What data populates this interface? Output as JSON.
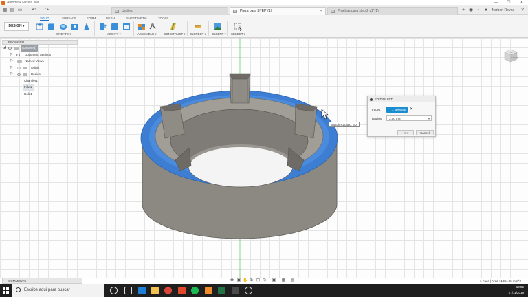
{
  "window": {
    "title": "Autodesk Fusion 360",
    "controls": [
      "—",
      "☐",
      "✕"
    ]
  },
  "tabs": [
    {
      "label": "Untitled",
      "active": false
    },
    {
      "label": "Pieza para STEP*(1)",
      "active": true
    },
    {
      "label": "Pruebas para step 2 v1*(1)",
      "active": false
    }
  ],
  "user": {
    "name": "Norbert Revea"
  },
  "toolbar": {
    "workspace_label": "DESIGN ▾",
    "workspace_tabs": [
      "SOLID",
      "SURFACE",
      "FORM",
      "MESH",
      "SHEET METAL",
      "TOOLS"
    ],
    "active_tab": "SOLID",
    "groups": [
      "CREATE ▾",
      "MODIFY ▾",
      "ASSEMBLE ▾",
      "CONSTRUCT ▾",
      "INSPECT ▾",
      "INSERT ▾",
      "SELECT ▾"
    ]
  },
  "browser": {
    "title": "BROWSER",
    "root": "(Unsaved)",
    "items": [
      {
        "label": "Document Settings"
      },
      {
        "label": "Named Views"
      },
      {
        "label": "Origin"
      },
      {
        "label": "Bodies"
      }
    ],
    "timeline": [
      "Chamfer1",
      "Fillet2",
      "Hole1"
    ]
  },
  "viewcube": {
    "top": "TOP",
    "front": "FRONT"
  },
  "tooltip": {
    "text": "Match Radius : 3D"
  },
  "dialog": {
    "title": "EDIT FILLET",
    "faces_label": "Faces",
    "faces_value": "1 selected",
    "radius_label": "Radius",
    "radius_value": "3.00 mm",
    "ok_label": "OK",
    "cancel_label": "Cancel"
  },
  "comments": {
    "label": "COMMENTS"
  },
  "status": {
    "text": "1 Face | Area : 1884.95 mm^2"
  },
  "taskbar": {
    "search_placeholder": "Escribe aquí para buscar",
    "time": "10:55",
    "date": "07/11/2019"
  },
  "colors": {
    "selection_blue": "#3d7ed2",
    "accent": "#1a8dd1",
    "model_gray": "#8c8983"
  }
}
